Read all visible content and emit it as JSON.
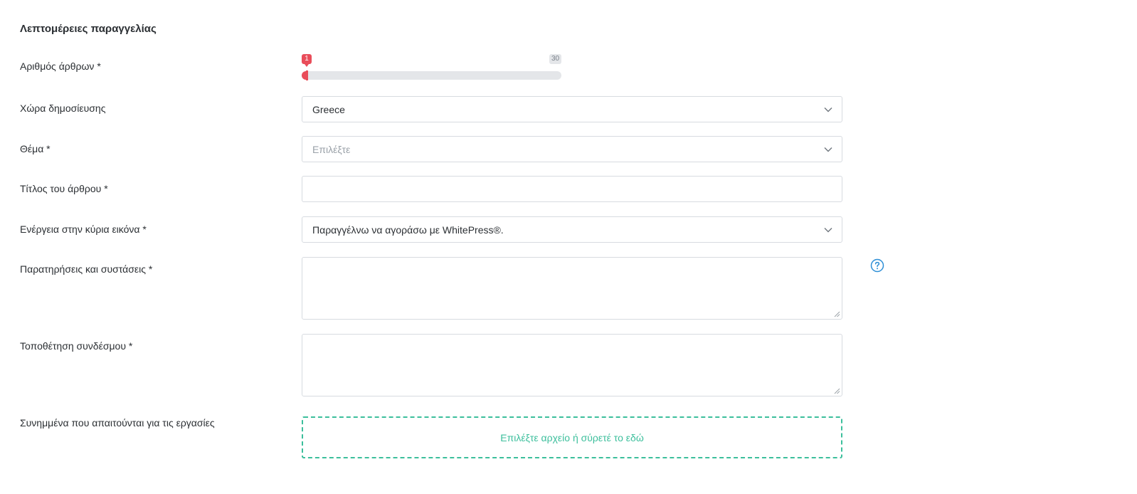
{
  "section": {
    "title": "Λεπτομέρειες παραγγελίας"
  },
  "fields": {
    "article_count": {
      "label": "Αριθμός άρθρων *",
      "current": "1",
      "max": "30",
      "fill_fraction": 0.02
    },
    "country": {
      "label": "Χώρα δημοσίευσης",
      "value": "Greece"
    },
    "topic": {
      "label": "Θέμα *",
      "placeholder": "Επιλέξτε"
    },
    "article_title": {
      "label": "Τίτλος του άρθρου *",
      "value": ""
    },
    "main_image_action": {
      "label": "Ενέργεια στην κύρια εικόνα *",
      "value": "Παραγγέλνω να αγοράσω με WhitePress®."
    },
    "notes": {
      "label": "Παρατηρήσεις και συστάσεις *",
      "value": ""
    },
    "link_placement": {
      "label": "Τοποθέτηση συνδέσμου *",
      "value": ""
    },
    "attachments": {
      "label": "Συνημμένα που απαιτούνται για τις εργασίες",
      "dropzone_text": "Επιλέξτε αρχείο ή σύρετέ το εδώ"
    }
  },
  "icons": {
    "dropdown": "chevron-down-icon",
    "help": "question-circle-icon"
  },
  "colors": {
    "slider_accent": "#e94d5a",
    "dropzone_accent": "#3cbf9c",
    "help_icon": "#2e8fd6"
  }
}
